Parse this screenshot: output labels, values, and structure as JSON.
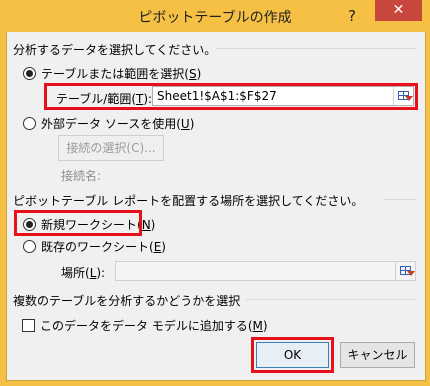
{
  "window": {
    "title": "ピボットテーブルの作成",
    "help_glyph": "?",
    "close_glyph": "✕"
  },
  "section1": {
    "heading": "分析するデータを選択してください。",
    "option_table_range": {
      "label": "テーブルまたは範囲を選択(",
      "key": "S",
      "close": ")",
      "selected": true
    },
    "range_label": {
      "label": "テーブル/範囲(",
      "key": "T",
      "close": "):"
    },
    "range_value": "Sheet1!$A$1:$F$27",
    "option_external": {
      "label": "外部データ ソースを使用(",
      "key": "U",
      "close": ")",
      "selected": false
    },
    "choose_connection_button": "接続の選択(C)...",
    "connection_name_label": "接続名:"
  },
  "section2": {
    "heading": "ピボットテーブル レポートを配置する場所を選択してください。",
    "option_new_sheet": {
      "label": "新規ワークシート(",
      "key": "N",
      "close": ")",
      "selected": true
    },
    "option_existing_sheet": {
      "label": "既存のワークシート(",
      "key": "E",
      "close": ")",
      "selected": false
    },
    "location_label": {
      "label": "場所(",
      "key": "L",
      "close": "):"
    },
    "location_value": ""
  },
  "section3": {
    "heading": "複数のテーブルを分析するかどうかを選択",
    "add_to_data_model": {
      "label": "このデータをデータ モデルに追加する(",
      "key": "M",
      "close": ")",
      "checked": false
    }
  },
  "buttons": {
    "ok": "OK",
    "cancel": "キャンセル"
  },
  "colors": {
    "titlebar": "#f6c044",
    "close_button": "#c9483d",
    "highlight": "#e8101a"
  }
}
